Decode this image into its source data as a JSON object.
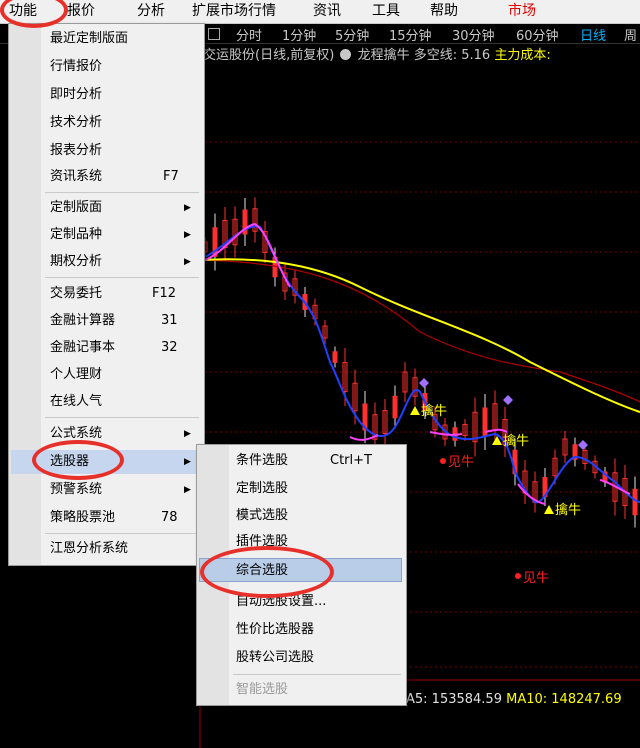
{
  "menubar": {
    "items": [
      "功能",
      "报价",
      "分析",
      "扩展市场行情",
      "资讯",
      "工具",
      "帮助"
    ],
    "market": "市场"
  },
  "chart": {
    "periods": [
      "分时",
      "1分钟",
      "5分钟",
      "15分钟",
      "30分钟",
      "60分钟",
      "日线",
      "周"
    ],
    "active_period": "日线",
    "title": "交运股份(日线,前复权)",
    "indicator": "龙程擒牛",
    "ls_label": "多空线:",
    "ls_value": "5.16",
    "cost_label": "主力成本:",
    "markers": [
      "擒牛",
      "擒牛",
      "擒牛",
      "见牛",
      "见牛"
    ],
    "ma5": "A5: 153584.59",
    "ma10": "MA10: 148247.69",
    "colors": {
      "price_up": "#ff2020",
      "ma_blue": "#3050ff",
      "ma_magenta": "#ff40ff",
      "ma_yellow": "#ffff00",
      "ma_red": "#c00000"
    }
  },
  "function_menu": {
    "items": [
      {
        "label": "最近定制版面"
      },
      {
        "label": "行情报价"
      },
      {
        "label": "即时分析"
      },
      {
        "label": "技术分析"
      },
      {
        "label": "报表分析"
      },
      {
        "label": "资讯系统",
        "shortcut": "F7"
      },
      {
        "label": "定制版面",
        "submenu": true
      },
      {
        "label": "定制品种",
        "submenu": true
      },
      {
        "label": "期权分析",
        "submenu": true
      },
      {
        "label": "交易委托",
        "shortcut": "F12"
      },
      {
        "label": "金融计算器",
        "shortcut": "31"
      },
      {
        "label": "金融记事本",
        "shortcut": "32"
      },
      {
        "label": "个人理财"
      },
      {
        "label": "在线人气"
      },
      {
        "label": "公式系统",
        "submenu": true
      },
      {
        "label": "选股器",
        "submenu": true
      },
      {
        "label": "预警系统",
        "submenu": true
      },
      {
        "label": "策略股票池",
        "shortcut": "78"
      },
      {
        "label": "江恩分析系统"
      }
    ]
  },
  "stock_picker_menu": {
    "items": [
      {
        "label": "条件选股",
        "shortcut": "Ctrl+T"
      },
      {
        "label": "定制选股"
      },
      {
        "label": "模式选股"
      },
      {
        "label": "插件选股"
      },
      {
        "label": "综合选股"
      },
      {
        "label": "自动选股设置..."
      },
      {
        "label": "性价比选股器"
      },
      {
        "label": "股转公司选股"
      },
      {
        "label": "智能选股"
      }
    ]
  }
}
